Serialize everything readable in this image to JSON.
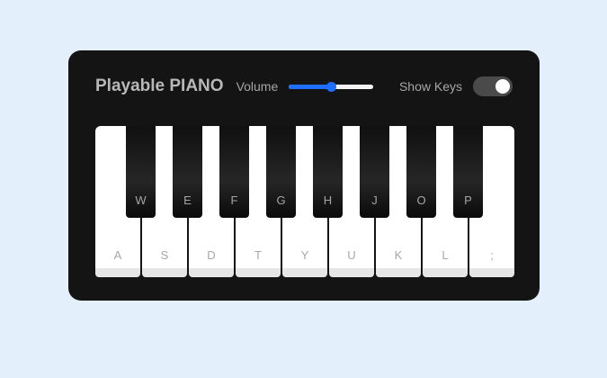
{
  "title": "Playable PIANO",
  "volume": {
    "label": "Volume",
    "value_percent": 50,
    "accent_color": "#1e6fff"
  },
  "show_keys": {
    "label": "Show Keys",
    "enabled": true
  },
  "white_keys": [
    "A",
    "S",
    "D",
    "T",
    "Y",
    "U",
    "K",
    "L",
    ";"
  ],
  "black_keys": [
    "W",
    "E",
    "F",
    "G",
    "H",
    "J",
    "O",
    "P"
  ],
  "colors": {
    "page_background": "#e3f0fc",
    "panel_background": "#141414"
  }
}
